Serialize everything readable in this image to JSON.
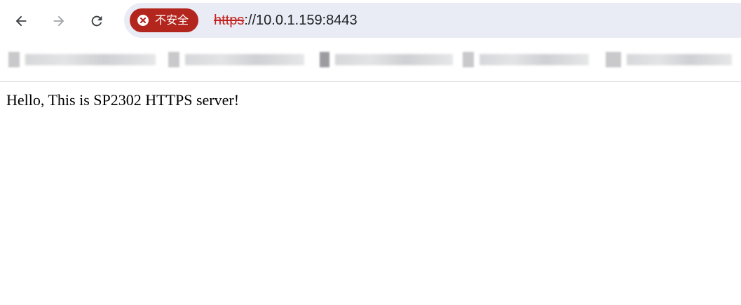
{
  "browser": {
    "security_label": "不安全",
    "url_scheme": "https",
    "url_rest": "://10.0.1.159:8443",
    "icons": {
      "back": "arrow-left-icon",
      "forward": "arrow-right-icon",
      "reload": "reload-icon",
      "security": "close-circle-icon"
    },
    "colors": {
      "security_chip": "#b3261e",
      "url_scheme": "#c5221f",
      "omnibox": "#e9ecf5"
    }
  },
  "page": {
    "body_text": "Hello, This is SP2302 HTTPS server!"
  }
}
